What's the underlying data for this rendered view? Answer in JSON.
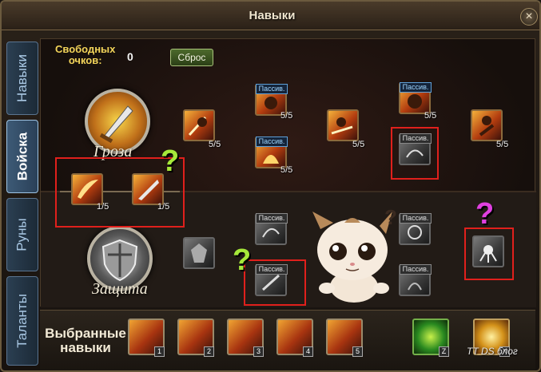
{
  "window": {
    "title": "Навыки",
    "close_symbol": "×"
  },
  "tabs": [
    {
      "label": "Навыки",
      "active": false
    },
    {
      "label": "Войска",
      "active": true
    },
    {
      "label": "Руны",
      "active": false
    },
    {
      "label": "Таланты",
      "active": false
    }
  ],
  "points": {
    "label_line1": "Свободных",
    "label_line2": "очков:",
    "value": "0",
    "reset_label": "Сброс"
  },
  "branches": {
    "upper_name": "Гроза",
    "lower_name": "Защита"
  },
  "skills": {
    "upper": [
      {
        "count": "5/5"
      },
      {
        "passive": "Пассив.",
        "count": "5/5"
      },
      {
        "passive": "Пассив.",
        "count": "5/5"
      },
      {
        "count": "5/5"
      },
      {
        "passive": "Пассив.",
        "count": "5/5"
      },
      {
        "passive": "Пассив."
      },
      {
        "count": "5/5"
      },
      {
        "count": "1/5"
      },
      {
        "count": "1/5"
      }
    ],
    "lower": [
      {
        "passive": "Пассив."
      },
      {
        "passive": "Пассив."
      },
      {
        "passive": "Пассив."
      },
      {
        "passive": "Пассив."
      }
    ]
  },
  "selected": {
    "label_line1": "Выбранные",
    "label_line2": "навыки",
    "slots": [
      "1",
      "2",
      "3",
      "4",
      "5",
      "Z",
      "X"
    ]
  },
  "annotations": {
    "question_mark": "?",
    "colors": {
      "green": "#a6e83a",
      "magenta": "#e040e0",
      "red": "#e0201c"
    }
  },
  "watermark": "TT DS блог"
}
